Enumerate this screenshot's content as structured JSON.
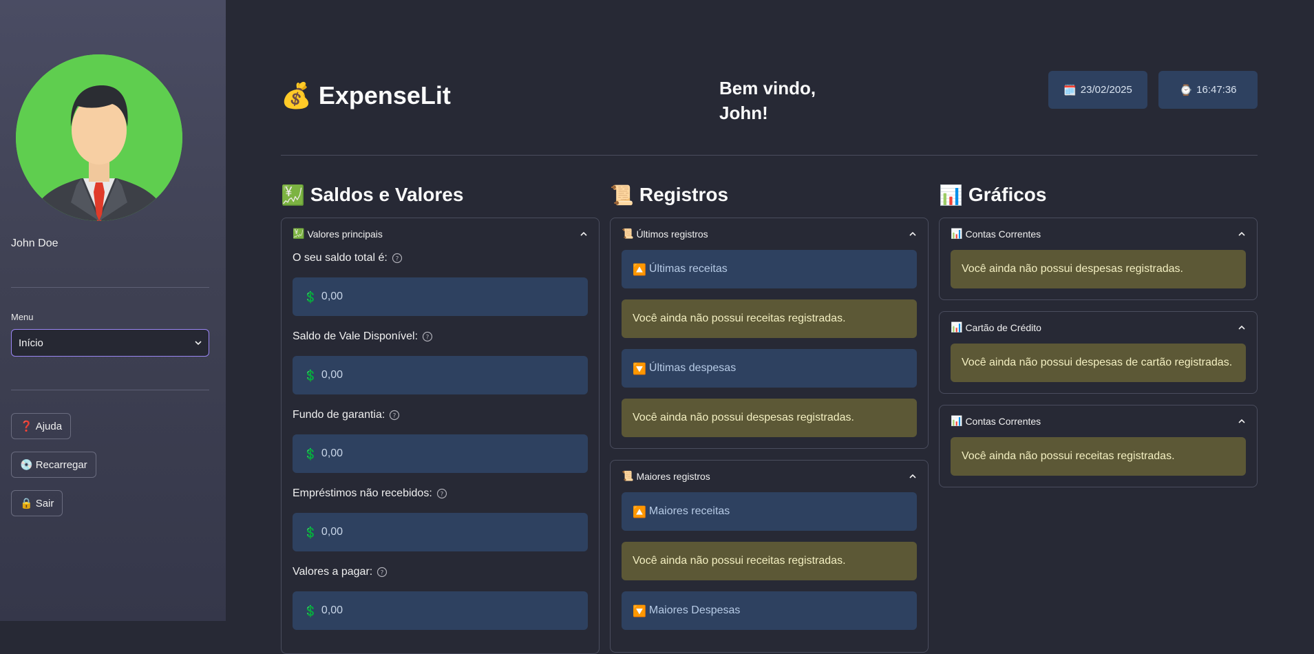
{
  "sidebar": {
    "user_name": "John Doe",
    "menu_label": "Menu",
    "menu_value": "Início",
    "buttons": [
      {
        "icon": "❓",
        "label": "Ajuda"
      },
      {
        "icon": "💿",
        "label": "Recarregar"
      },
      {
        "icon": "🔒",
        "label": "Sair"
      }
    ]
  },
  "header": {
    "app_icon": "💰",
    "app_title": "ExpenseLit",
    "welcome_line1": "Bem vindo,",
    "welcome_line2": "John!",
    "date_icon": "🗓️",
    "date": "23/02/2025",
    "time_icon": "⌚",
    "time": "16:47:36"
  },
  "col1": {
    "icon": "💹",
    "title": "Saldos e Valores",
    "expander_icon": "💹",
    "expander_label": "Valores principais",
    "currency_icon": "💲",
    "fields": [
      {
        "label": "O seu saldo total é:",
        "value": "0,00"
      },
      {
        "label": "Saldo de Vale Disponível:",
        "value": "0,00"
      },
      {
        "label": "Fundo de garantia:",
        "value": "0,00"
      },
      {
        "label": "Empréstimos não recebidos:",
        "value": "0,00"
      },
      {
        "label": "Valores a pagar:",
        "value": "0,00"
      }
    ]
  },
  "col2": {
    "icon": "📜",
    "title": "Registros",
    "exp1": {
      "icon": "📜",
      "label": "Últimos registros",
      "income_title": "Últimas receitas",
      "income_empty": "Você ainda não possui receitas registradas.",
      "expense_title": "Últimas despesas",
      "expense_empty": "Você ainda não possui despesas registradas."
    },
    "exp2": {
      "icon": "📜",
      "label": "Maiores registros",
      "income_title": "Maiores receitas",
      "income_empty": "Você ainda não possui receitas registradas.",
      "expense_title": "Maiores Despesas"
    },
    "up_icon": "🔼",
    "down_icon": "🔽"
  },
  "col3": {
    "icon": "📊",
    "title": "Gráficos",
    "expanders": [
      {
        "icon": "📊",
        "label": "Contas Correntes",
        "message": "Você ainda não possui despesas registradas."
      },
      {
        "icon": "📊",
        "label": "Cartão de Crédito",
        "message": "Você ainda não possui despesas de cartão registradas."
      },
      {
        "icon": "📊",
        "label": "Contas Correntes",
        "message": "Você ainda não possui receitas registradas."
      }
    ]
  },
  "colors": {
    "background": "#272935",
    "sidebar": "#3f4153",
    "info_bg": "#2e4160",
    "warning_bg": "#5c5836",
    "avatar_bg": "#5fce4f",
    "select_border": "#9b87f5"
  }
}
